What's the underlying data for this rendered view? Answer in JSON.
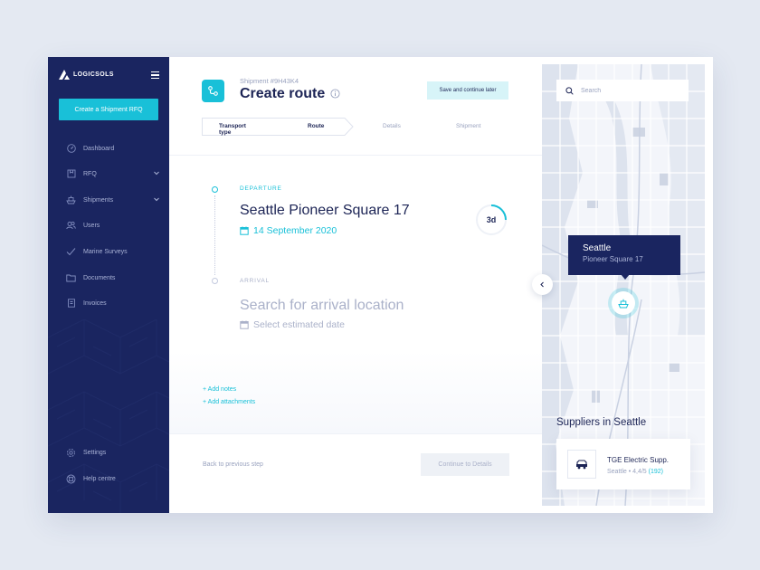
{
  "sidebar": {
    "logo_text": "LOGICSOLS",
    "cta_label": "Create a Shipment RFQ",
    "items": [
      {
        "label": "Dashboard",
        "icon": "dashboard-icon"
      },
      {
        "label": "RFQ",
        "icon": "rfq-icon",
        "has_chevron": true
      },
      {
        "label": "Shipments",
        "icon": "ship-icon",
        "has_chevron": true
      },
      {
        "label": "Users",
        "icon": "users-icon"
      },
      {
        "label": "Marine Surveys",
        "icon": "check-icon"
      },
      {
        "label": "Documents",
        "icon": "folder-icon"
      },
      {
        "label": "Invoices",
        "icon": "invoice-icon"
      }
    ],
    "bottom_items": [
      {
        "label": "Settings",
        "icon": "gear-icon"
      },
      {
        "label": "Help centre",
        "icon": "lifebuoy-icon"
      }
    ]
  },
  "header": {
    "shipment_id": "Shipment #9H43K4",
    "title": "Create route",
    "save_later_label": "Save and continue later"
  },
  "stepper": {
    "steps": [
      "Transport type",
      "Route",
      "Details",
      "Shipment"
    ],
    "active_through": 1
  },
  "route": {
    "departure_label": "DEPARTURE",
    "departure_place": "Seattle Pioneer Square 17",
    "departure_date": "14 September 2020",
    "duration": "3d",
    "arrival_label": "ARRIVAL",
    "arrival_placeholder": "Search for arrival location",
    "arrival_date_placeholder": "Select estimated date",
    "add_notes": "+ Add notes",
    "add_attachments": "+ Add attachments"
  },
  "footer": {
    "back_label": "Back to previous step",
    "continue_label": "Continue to Details"
  },
  "map": {
    "search_placeholder": "Search",
    "tooltip_title": "Seattle",
    "tooltip_sub": "Pioneer Square 17",
    "suppliers_title": "Suppliers in Seattle",
    "supplier": {
      "name": "TGE Electric Supp.",
      "meta": "Seattle • 4,4/5",
      "count": "(192)"
    }
  },
  "colors": {
    "accent": "#19c0d8",
    "navy": "#1a2560",
    "muted": "#9aa3bf"
  }
}
